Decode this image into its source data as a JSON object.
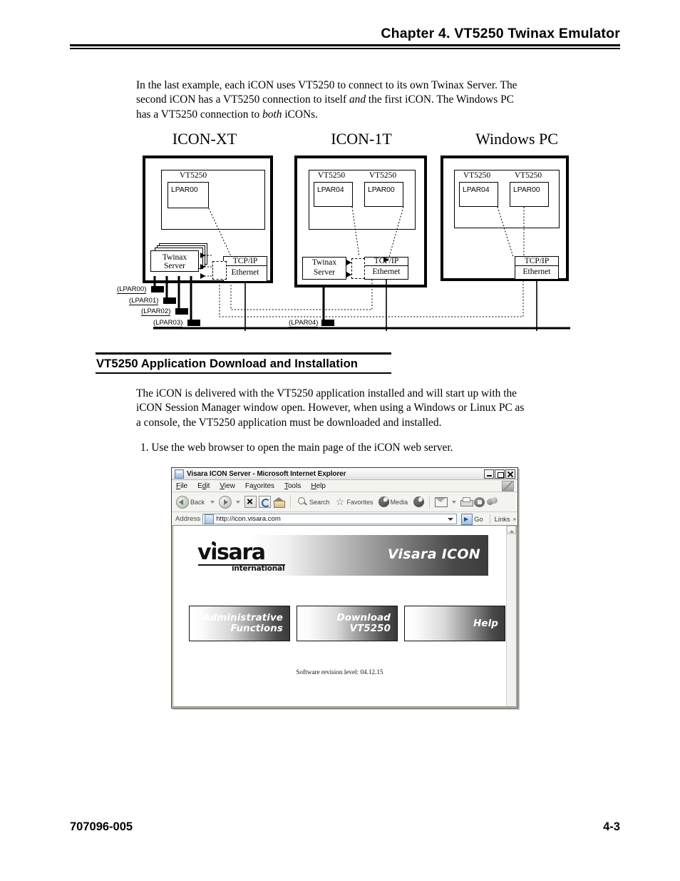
{
  "header": {
    "title": "Chapter 4.  VT5250 Twinax Emulator"
  },
  "intro": {
    "line1": "In the last example, each iCON uses VT5250 to connect to its own Twinax Server. The",
    "line2a": "second iCON has a VT5250 connection to itself ",
    "line2i": "and",
    "line2b": " the first iCON. The Windows PC",
    "line3a": "has a VT5250 connection to ",
    "line3i": "both",
    "line3b": " iCONs."
  },
  "diagram": {
    "panels": [
      {
        "title": "ICON-XT",
        "vt5250": [
          "VT5250"
        ],
        "lpars": [
          "LPAR00"
        ]
      },
      {
        "title": "ICON-1T",
        "vt5250": [
          "VT5250",
          "VT5250"
        ],
        "lpars": [
          "LPAR04",
          "LPAR00"
        ]
      },
      {
        "title": "Windows PC",
        "vt5250": [
          "VT5250",
          "VT5250"
        ],
        "lpars": [
          "LPAR04",
          "LPAR00"
        ]
      }
    ],
    "twinax_label_line1": "Twinax",
    "twinax_label_line2": "Server",
    "tcpip_label_line1": "TCP/IP",
    "tcpip_label_line2": "Ethernet",
    "bus_labels": [
      "(LPAR00)",
      "(LPAR01)",
      "(LPAR02)",
      "(LPAR03)",
      "(LPAR04)"
    ]
  },
  "section": {
    "title": "VT5250 Application Download and Installation",
    "body_line1": "The iCON is delivered with the VT5250 application installed and will start up with the",
    "body_line2": "iCON Session Manager window open. However, when using a Windows or Linux PC as",
    "body_line3": "a console, the VT5250 application must be downloaded and installed.",
    "step1": "1.  Use the web browser to open the main page of the iCON web server."
  },
  "browser": {
    "title": "Visara ICON Server - Microsoft Internet Explorer",
    "menu": [
      "File",
      "Edit",
      "View",
      "Favorites",
      "Tools",
      "Help"
    ],
    "toolbar": {
      "back": "Back",
      "search": "Search",
      "favorites": "Favorites",
      "media": "Media"
    },
    "address_label": "Address",
    "address_value": "http://icon.visara.com",
    "go_label": "Go",
    "links_label": "Links",
    "window_buttons": [
      "minimize",
      "maximize",
      "close"
    ]
  },
  "webpage": {
    "logo_text": "visara",
    "logo_sub": "international",
    "banner_right": "Visara ICON",
    "buttons": [
      {
        "label": "Administrative\nFunctions"
      },
      {
        "label": "Download\nVT5250"
      },
      {
        "label": "Help"
      }
    ],
    "revision": "Software revision level: 04.12.15"
  },
  "footer": {
    "left": "707096-005",
    "right": "4-3"
  },
  "colors": {
    "ink": "#000000",
    "banner_dark": "#3c3c3c",
    "browser_chrome": "#f3f3f0"
  }
}
